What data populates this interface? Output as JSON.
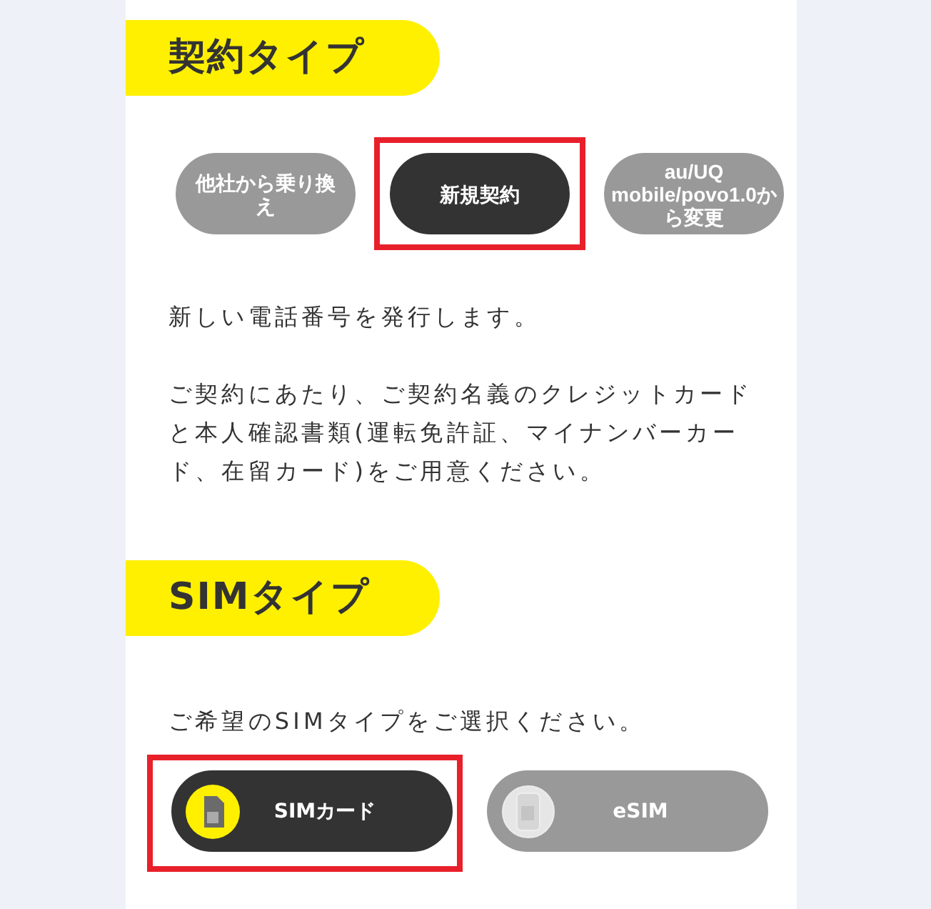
{
  "sections": [
    {
      "heading": "契約タイプ",
      "options": [
        {
          "label": "他社から乗り換え",
          "selected": false
        },
        {
          "label": "新規契約",
          "selected": true
        },
        {
          "label": "au/UQ mobile/povo1.0から変更",
          "selected": false
        }
      ],
      "paragraphs": [
        "新しい電話番号を発行します。",
        "ご契約にあたり、ご契約名義のクレジットカードと本人確認書類(運転免許証、マイナンバーカード、在留カード)をご用意ください。"
      ]
    },
    {
      "heading": "SIMタイプ",
      "paragraphs": [
        "ご希望のSIMタイプをご選択ください。"
      ],
      "sim_options": [
        {
          "label": "SIMカード",
          "kind": "sim",
          "selected": true
        },
        {
          "label": "eSIM",
          "kind": "esim",
          "selected": false
        }
      ]
    }
  ]
}
